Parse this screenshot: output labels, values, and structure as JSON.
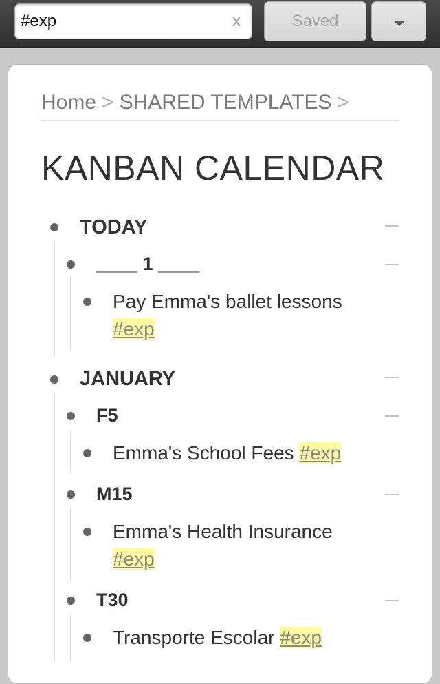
{
  "search": {
    "value": "#exp",
    "clear_label": "x"
  },
  "toolbar": {
    "saved_label": "Saved"
  },
  "breadcrumb": {
    "home": "Home",
    "folder": "SHARED TEMPLATES",
    "separator": ">"
  },
  "page": {
    "title": "KANBAN CALENDAR"
  },
  "outline": {
    "today": {
      "label": "TODAY",
      "child_label": "____ 1 ____",
      "item_text": "Pay Emma's ballet lessons",
      "item_tag": "#exp"
    },
    "january": {
      "label": "JANUARY",
      "f5": {
        "label": "F5",
        "item_text": "Emma's School Fees",
        "item_tag": "#exp"
      },
      "m15": {
        "label": "M15",
        "item_text": "Emma's Health Insurance",
        "item_tag": "#exp"
      },
      "t30": {
        "label": "T30",
        "item_text": "Transporte Escolar",
        "item_tag": "#exp"
      }
    }
  },
  "colors": {
    "tag_highlight": "#fffaa0",
    "topbar": "#3a3a3a",
    "background": "#c9c9c9"
  }
}
